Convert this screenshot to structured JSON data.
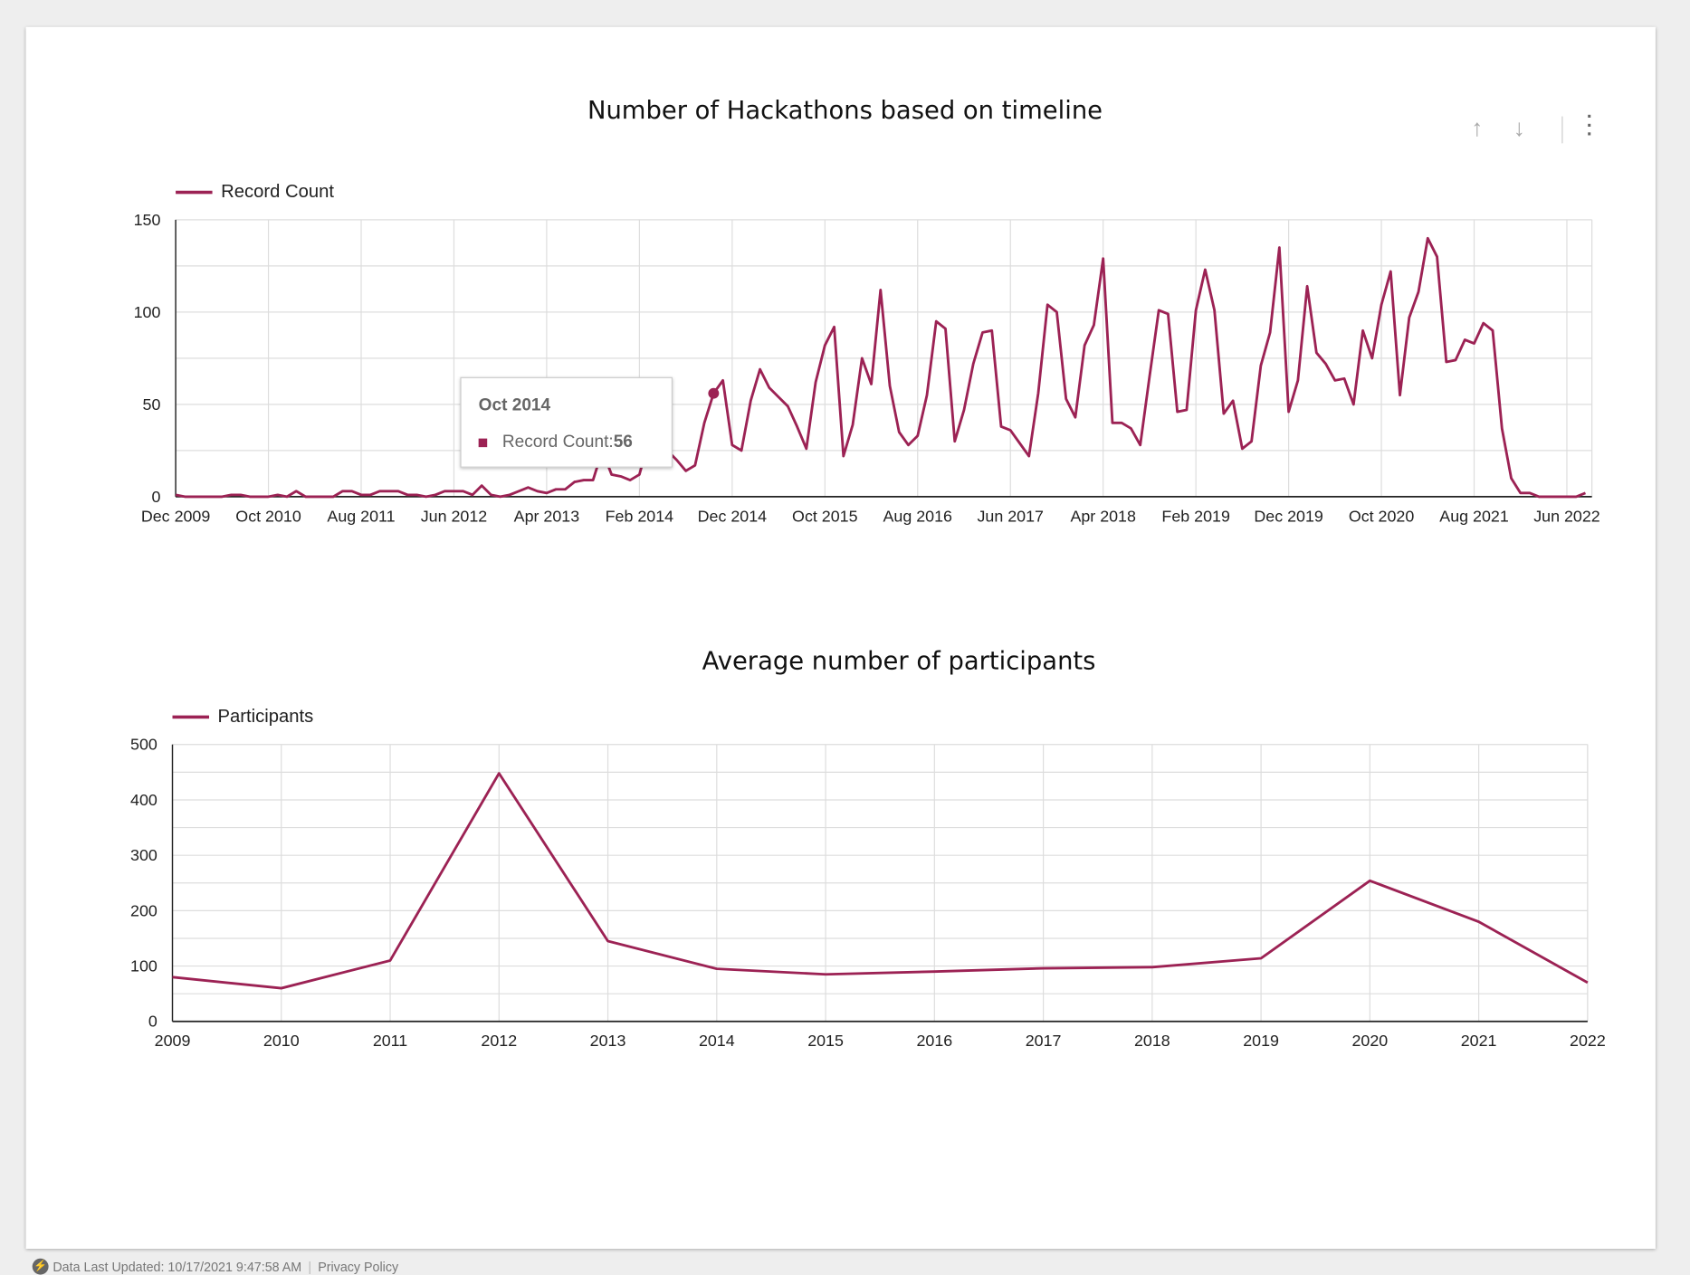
{
  "toolbar": {
    "icons": [
      "arrow-up-icon",
      "arrow-down-icon",
      "more-vert-icon"
    ]
  },
  "accent_color": "#9c2254",
  "footer": {
    "updated": "Data Last Updated: 10/17/2021 9:47:58 AM",
    "privacy": "Privacy Policy"
  },
  "tooltip": {
    "date": "Oct 2014",
    "label": "Record Count: ",
    "value": "56"
  },
  "chart_data": [
    {
      "type": "line",
      "title": "Number of Hackathons based on timeline",
      "series": [
        {
          "name": "Record Count",
          "start": "Dec 2009",
          "interval": "month",
          "values": [
            1,
            0,
            0,
            0,
            0,
            0,
            1,
            1,
            0,
            0,
            0,
            1,
            0,
            3,
            0,
            0,
            0,
            0,
            3,
            3,
            1,
            1,
            3,
            3,
            3,
            1,
            1,
            0,
            1,
            3,
            3,
            3,
            1,
            6,
            1,
            0,
            1,
            3,
            5,
            3,
            2,
            4,
            4,
            8,
            9,
            9,
            25,
            12,
            11,
            9,
            12,
            30,
            28,
            25,
            20,
            14,
            17,
            40,
            56,
            63,
            28,
            25,
            52,
            69,
            59,
            54,
            49,
            38,
            26,
            62,
            82,
            92,
            22,
            39,
            75,
            61,
            112,
            60,
            35,
            28,
            33,
            55,
            95,
            91,
            30,
            47,
            72,
            89,
            90,
            38,
            36,
            29,
            22,
            56,
            104,
            100,
            53,
            43,
            82,
            93,
            129,
            40,
            40,
            37,
            28,
            65,
            101,
            99,
            46,
            47,
            101,
            123,
            101,
            45,
            52,
            26,
            30,
            71,
            89,
            135,
            46,
            63,
            114,
            78,
            72,
            63,
            64,
            50,
            90,
            75,
            104,
            122,
            55,
            97,
            111,
            140,
            130,
            73,
            74,
            85,
            83,
            94,
            90,
            37,
            10,
            2,
            2,
            0,
            0,
            0,
            0,
            0,
            2
          ]
        }
      ],
      "x_tick_labels": [
        "Dec 2009",
        "Oct 2010",
        "Aug 2011",
        "Jun 2012",
        "Apr 2013",
        "Feb 2014",
        "Dec 2014",
        "Oct 2015",
        "Aug 2016",
        "Jun 2017",
        "Apr 2018",
        "Feb 2019",
        "Dec 2019",
        "Oct 2020",
        "Aug 2021",
        "Jun 2022"
      ],
      "y_ticks": [
        0,
        50,
        100,
        150
      ],
      "ylim": [
        0,
        150
      ],
      "grid": true,
      "legend": "top-left",
      "highlight": {
        "x": "Oct 2014",
        "y": 56
      }
    },
    {
      "type": "line",
      "title": "Average number of participants",
      "categories": [
        "2009",
        "2010",
        "2011",
        "2012",
        "2013",
        "2014",
        "2015",
        "2016",
        "2017",
        "2018",
        "2019",
        "2020",
        "2021",
        "2022"
      ],
      "series": [
        {
          "name": "Participants",
          "values": [
            80,
            60,
            110,
            448,
            145,
            95,
            85,
            90,
            96,
            98,
            114,
            254,
            180,
            70
          ]
        }
      ],
      "y_ticks": [
        0,
        100,
        200,
        300,
        400,
        500
      ],
      "ylim": [
        0,
        500
      ],
      "grid": true,
      "legend": "top-left"
    }
  ]
}
